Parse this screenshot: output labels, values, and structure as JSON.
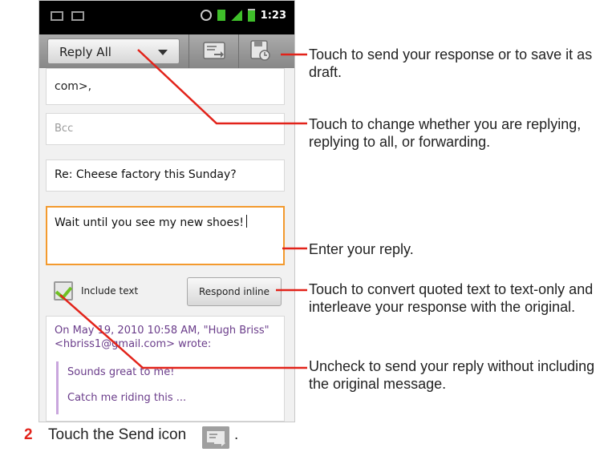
{
  "status_bar": {
    "time": "1:23"
  },
  "action_bar": {
    "reply_mode": "Reply All",
    "send_icon": "send-icon",
    "save_draft_icon": "save-draft-icon"
  },
  "compose": {
    "to_value": "com>,",
    "bcc_placeholder": "Bcc",
    "subject": "Re: Cheese factory this Sunday?",
    "body": "Wait until you see my new shoes!"
  },
  "quote_controls": {
    "include_text_label": "Include text",
    "include_text_checked": true,
    "respond_inline_label": "Respond inline"
  },
  "quoted_message": {
    "header": "On May 19, 2010 10:58 AM, \"Hugh Briss\" <hbriss1@gmail.com> wrote:",
    "lines": [
      "Sounds great to me!",
      "Catch me riding this ..."
    ]
  },
  "callouts": {
    "send_or_save": "Touch to send your response or to save it as draft.",
    "change_mode": "Touch to change whether you are replying, replying to all, or forwarding.",
    "enter_reply": "Enter your reply.",
    "respond_inline": "Touch to convert quoted text to text-only and interleave your response with the original.",
    "uncheck_include": "Uncheck to send your reply without including the original message."
  },
  "step": {
    "number": "2",
    "text": "Touch the Send icon",
    "end": "."
  },
  "colors": {
    "leader_line": "#e2231a",
    "focus_border": "#f39a2e",
    "step_number": "#e2231a"
  }
}
